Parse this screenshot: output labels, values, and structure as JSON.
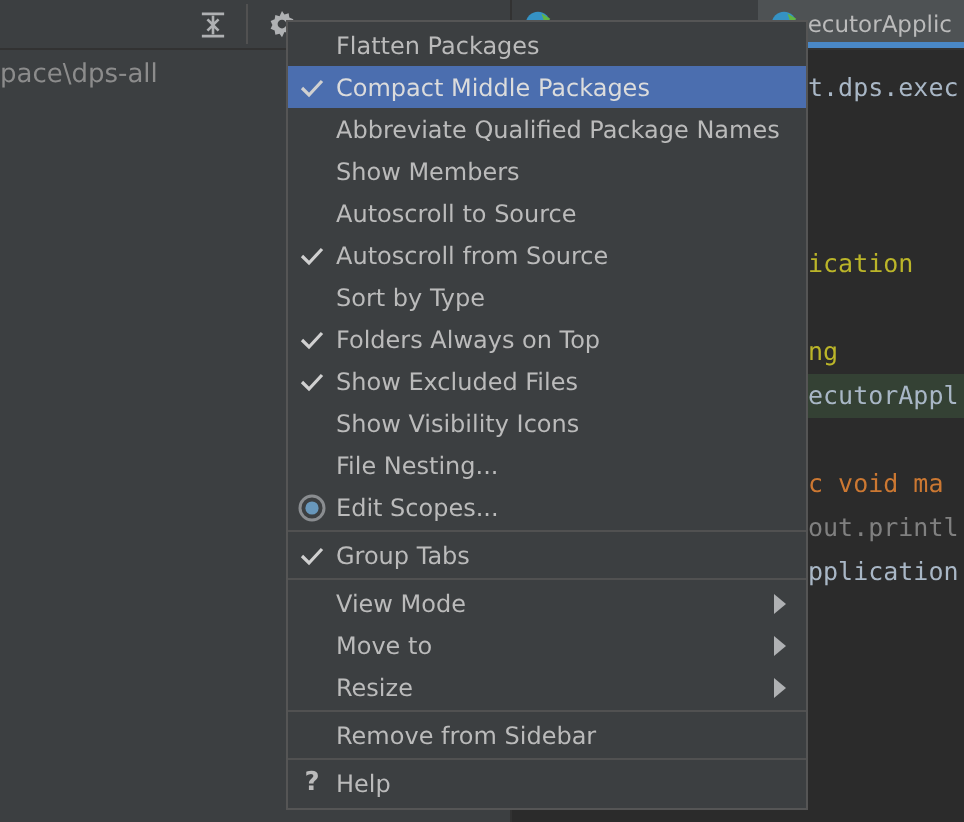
{
  "project_panel": {
    "path": "pace\\dps-all"
  },
  "editor": {
    "tabs": [
      {
        "selected": false
      },
      {
        "label": "ecutorApplic",
        "selected": true
      }
    ],
    "lines": [
      {
        "text": "t.dps.exec",
        "kind": "plain",
        "highlighted": false
      },
      {
        "kind": "blank",
        "highlighted": false
      },
      {
        "kind": "blank",
        "highlighted": false
      },
      {
        "kind": "blank",
        "highlighted": false
      },
      {
        "text": "ication",
        "kind": "annotation",
        "highlighted": false
      },
      {
        "kind": "blank",
        "highlighted": false
      },
      {
        "text": "ng",
        "kind": "annotation",
        "highlighted": false
      },
      {
        "text": "ecutorAppl",
        "kind": "plain",
        "highlighted": true
      },
      {
        "kind": "blank",
        "highlighted": false
      },
      {
        "text": "c void ma",
        "kind": "keyword",
        "highlighted": false
      },
      {
        "text": "out.printl",
        "kind": "muted",
        "highlighted": false
      },
      {
        "text": "pplication",
        "kind": "plain",
        "highlighted": false
      }
    ]
  },
  "menu": {
    "groups": [
      [
        {
          "label": "Flatten Packages",
          "kind": "check",
          "checked": false,
          "selected": false
        },
        {
          "label": "Compact Middle Packages",
          "kind": "check",
          "checked": true,
          "selected": true
        },
        {
          "label": "Abbreviate Qualified Package Names",
          "kind": "check",
          "checked": false,
          "selected": false
        },
        {
          "label": "Show Members",
          "kind": "check",
          "checked": false,
          "selected": false
        },
        {
          "label": "Autoscroll to Source",
          "kind": "check",
          "checked": false,
          "selected": false
        },
        {
          "label": "Autoscroll from Source",
          "kind": "check",
          "checked": true,
          "selected": false
        },
        {
          "label": "Sort by Type",
          "kind": "check",
          "checked": false,
          "selected": false
        },
        {
          "label": "Folders Always on Top",
          "kind": "check",
          "checked": true,
          "selected": false
        },
        {
          "label": "Show Excluded Files",
          "kind": "check",
          "checked": true,
          "selected": false
        },
        {
          "label": "Show Visibility Icons",
          "kind": "check",
          "checked": false,
          "selected": false
        },
        {
          "label": "File Nesting...",
          "kind": "plain",
          "selected": false
        },
        {
          "label": "Edit Scopes...",
          "kind": "scopes",
          "selected": false
        }
      ],
      [
        {
          "label": "Group Tabs",
          "kind": "check",
          "checked": true,
          "selected": false
        }
      ],
      [
        {
          "label": "View Mode",
          "kind": "submenu",
          "selected": false
        },
        {
          "label": "Move to",
          "kind": "submenu",
          "selected": false
        },
        {
          "label": "Resize",
          "kind": "submenu",
          "selected": false
        }
      ],
      [
        {
          "label": "Remove from Sidebar",
          "kind": "plain",
          "selected": false
        }
      ],
      [
        {
          "label": "Help",
          "kind": "help",
          "icon": "?",
          "selected": false
        }
      ]
    ]
  }
}
